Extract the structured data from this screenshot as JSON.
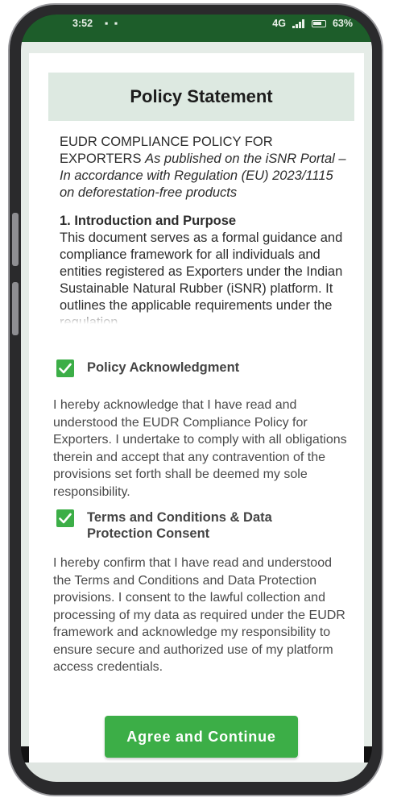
{
  "status_bar": {
    "time": "3:52",
    "notification_icons": "▪ ▪",
    "network_text": "4G",
    "battery_percent": "63%"
  },
  "dialog": {
    "title": "Policy Statement",
    "policy": {
      "heading": "EUDR COMPLIANCE POLICY FOR EXPORTERS",
      "subheading": "As published on the iSNR Portal – In accordance with Regulation (EU) 2023/1115 on deforestation-free products",
      "section_title": "1. Introduction and Purpose",
      "section_body": "This document serves as a formal guidance and compliance framework for all individuals and entities registered as Exporters under the Indian Sustainable Natural Rubber (iSNR) platform. It outlines the applicable requirements under the regulation."
    },
    "acknowledgment": {
      "checked": true,
      "label": "Policy Acknowledgment",
      "text": "I hereby acknowledge that I have read and understood the EUDR Compliance Policy for Exporters. I undertake to comply with all obligations therein and accept that any contravention of the provisions set forth shall be deemed my sole responsibility."
    },
    "consent": {
      "checked": true,
      "label": "Terms and Conditions & Data Protection Consent",
      "text": "I hereby confirm that I have read and understood the Terms and Conditions and Data Protection provisions. I consent to the lawful collection and processing of my data as required under the EUDR framework and acknowledge my responsibility to ensure secure and authorized use of my platform access credentials."
    },
    "agree_button_label": "Agree and Continue"
  },
  "colors": {
    "accent": "#3cae47",
    "header_bg": "#dde9e1",
    "status_bar": "#1d5d2a"
  },
  "icons": {
    "checkbox": "checkmark-icon",
    "battery": "battery-icon",
    "signal": "signal-icon"
  }
}
